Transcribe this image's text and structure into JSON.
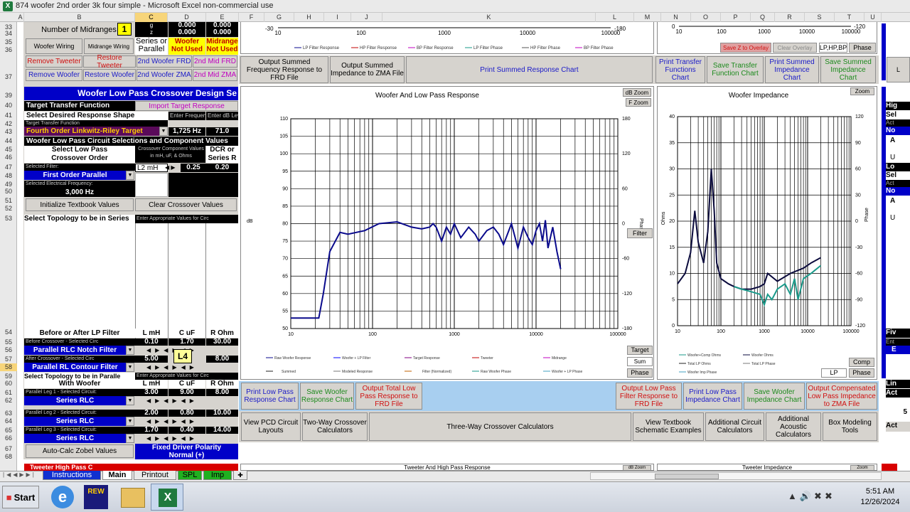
{
  "window": {
    "title": "874 woofer 2nd order 3k four simple - Microsoft Excel non-commercial use"
  },
  "columns": [
    "A",
    "B",
    "C",
    "D",
    "E",
    "F",
    "G",
    "H",
    "I",
    "J",
    "K",
    "L",
    "M",
    "N",
    "O",
    "P",
    "Q",
    "R",
    "S",
    "T",
    "U"
  ],
  "rows": [
    "33",
    "34",
    "35",
    "36",
    "37",
    "39",
    "40",
    "41",
    "42",
    "43",
    "44",
    "45",
    "46",
    "47",
    "48",
    "49",
    "50",
    "51",
    "52",
    "53",
    "54",
    "55",
    "56",
    "57",
    "58",
    "59",
    "60",
    "61",
    "62",
    "63",
    "64",
    "65",
    "66",
    "67",
    "68"
  ],
  "left": {
    "midranges_label": "Number of Midranges",
    "midranges_value": "1",
    "g_label": "g",
    "z_label": "z",
    "g_d": "0.000",
    "g_e": "0.000",
    "z_d": "0.000",
    "z_e": "0.000",
    "woofer_wiring": "Woofer Wiring",
    "midrange_wiring": "Midrange Wiring",
    "series_or_parallel": "Series or Parallel",
    "woofer_not_used": "Woofer Not Used",
    "midrange_not_used": "Midrange Not Used",
    "remove_tweeter": "Remove Tweeter",
    "restore_tweeter": "Restore Tweeter",
    "woofer2_frd": "2nd Woofer FRD",
    "mid2_frd": "2nd Mid FRD",
    "remove_woofer": "Remove Woofer",
    "restore_woofer": "Restore Woofer",
    "woofer2_zma": "2nd Woofer ZMA",
    "mid2_zma": "2nd Mid ZMA",
    "section_title": "Woofer Low Pass Crossover Design Se",
    "target_tf": "Target Transfer Function",
    "import_target": "Import Target Response",
    "select_shape": "Select Desired Response Shape",
    "enter_freq": "Enter Frequency",
    "enter_db": "Enter dB Level",
    "target_tf_small": "Target Transfer Function",
    "target_name": "Fourth Order Linkwitz-Riley Target",
    "freq_val": "1,725 Hz",
    "level_val": "71.0",
    "component_values": "Woofer Low Pass Circuit Selections and Component Values",
    "select_lp": "Select Low Pass",
    "crossover_order": "Crossover Order",
    "crossover_comp": "Crossover Component Values in mH, uF, & Ohms",
    "dcr": "DCR or",
    "series_r": "Series R",
    "selected_filter": "Selected Filter:",
    "filter_name": "First Order Parallel",
    "l2": "L2 mH",
    "l2_val": "0.25",
    "l2_r": "0.20",
    "sel_elec_freq": "Selected Electrical Frequency:",
    "freq3k": "3,000 Hz",
    "init_textbook": "Initialize Textbook Values",
    "clear_crossover": "Clear Crossover Values",
    "select_topology": "Select Topology to be in Series",
    "enter_appropriate": "Enter Appropriate Values for Circ",
    "before_after": "Before or After LP Filter",
    "l_mh": "L mH",
    "c_uf": "C uF",
    "r_ohm": "R Ohm",
    "before_sel": "Before Crossover - Selected Circ",
    "bf_l": "0.10",
    "bf_c": "1.70",
    "bf_r": "30.00",
    "notch": "Parallel RLC Notch Filter",
    "after_sel": "After Crossover - Selected Circ",
    "af_l": "5.00",
    "af_r": "8.00",
    "contour": "Parallel RL Contour Filter",
    "l4_tip": "L4",
    "topology_parallel": "Select Topology to be in Paralle",
    "enter_appropriate2": "Enter Appropriate Values for Circ",
    "with_woofer": "With Woofer",
    "leg1": "Parallel Leg 1 - Selected Circuit:",
    "leg1_l": "3.00",
    "leg1_c": "9.00",
    "leg1_r": "8.00",
    "series_rlc": "Series RLC",
    "leg2": "Parallel Leg 2 - Selected Circuit:",
    "leg2_l": "2.00",
    "leg2_c": "0.80",
    "leg2_r": "10.00",
    "leg3": "Parallel Leg 3 - Selected Circuit:",
    "leg3_l": "1.70",
    "leg3_c": "0.40",
    "leg3_r": "14.00",
    "autocalc": "Auto-Calc Zobel Values",
    "fixed_polarity": "Fixed Driver Polarity",
    "normal": "Normal (+)"
  },
  "top_charts": {
    "left_ticks": [
      "10",
      "100",
      "1000",
      "10000",
      "100000"
    ],
    "left_rt": "-180",
    "left_lt": "-30",
    "left_legend": [
      "LP Filter Response",
      "HP Filter Response",
      "BP Filter Response",
      "LP Filter Phase",
      "HP Filter Phase",
      "BP Filter Phase"
    ],
    "right_ticks": [
      "10",
      "100",
      "1000",
      "10000",
      "100000"
    ],
    "right_lt": "0",
    "right_rt": "-120",
    "save_z": "Save Z to Overlay",
    "clear_overlay": "Clear Overlay",
    "lphpbp": "LP,HP,BP",
    "phase": "Phase"
  },
  "buttons_row1": {
    "out_frd": "Output Summed Frequency Response to FRD File",
    "out_zma": "Output Summed Impedance to ZMA File",
    "print_summed": "Print Summed Response Chart",
    "print_tf": "Print Transfer Functions Chart",
    "save_tf": "Save Transfer Function Chart",
    "print_imp": "Print Summed Impedance Chart",
    "save_imp": "Save Summed Impedance Chart"
  },
  "response_chart": {
    "title": "Woofer And Low Pass Response",
    "db_zoom": "dB Zoom",
    "f_zoom": "F Zoom",
    "filter": "Filter",
    "target": "Target",
    "sum": "Sum",
    "phase": "Phase",
    "ylabel": "dB",
    "y2label": "Phase",
    "legend": [
      "Raw Woofer Response",
      "Woofer + LP Filter",
      "Target Response",
      "Tweeter",
      "Midrange",
      "Summed",
      "Modeled Response",
      "Filter (Normalized)",
      "Raw Woofer Phase",
      "Woofer + LP Phase"
    ]
  },
  "impedance_chart": {
    "title": "Woofer Impedance",
    "zoom": "Zoom",
    "comp": "Comp",
    "lp": "LP",
    "phase": "Phase",
    "ylabel": "Ohms",
    "y2label": "Phase",
    "legend": [
      "Woofer+Comp Ohms",
      "Woofer Ohms",
      "Total LP Ohms",
      "Total LP Phase",
      "Woofer Imp Phase"
    ]
  },
  "chart_data": [
    {
      "type": "line",
      "title": "Woofer And Low Pass Response",
      "xlabel": "",
      "ylabel": "dB",
      "xscale": "log",
      "xlim": [
        10,
        100000
      ],
      "ylim": [
        50,
        110
      ],
      "y2lim": [
        -180,
        180
      ],
      "x_ticks": [
        "10",
        "100",
        "1000",
        "10000",
        "100000"
      ],
      "y_ticks": [
        "50",
        "55",
        "60",
        "65",
        "70",
        "75",
        "80",
        "85",
        "90",
        "95",
        "100",
        "105",
        "110"
      ],
      "y2_ticks": [
        "-180",
        "-120",
        "-60",
        "0",
        "60",
        "120",
        "180"
      ],
      "series": [
        {
          "name": "Woofer + LP Filter",
          "x": [
            10,
            20,
            22,
            25,
            30,
            40,
            50,
            80,
            120,
            200,
            300,
            400,
            500,
            550,
            600,
            700,
            800,
            900,
            1000,
            1200,
            1500,
            1800,
            2000,
            2500,
            3000,
            3500,
            4000,
            5000,
            6000,
            7000,
            8000,
            9000,
            10000,
            11000,
            12000,
            13000,
            14000,
            16000,
            18000,
            20000
          ],
          "y": [
            53,
            53,
            53,
            60,
            72,
            77.5,
            77,
            78,
            80,
            80.5,
            79,
            78.5,
            79,
            80,
            79,
            75,
            79,
            77,
            80,
            76,
            79,
            77,
            75,
            78,
            79,
            77,
            74,
            80,
            73,
            79,
            76,
            74,
            78,
            80,
            75,
            81,
            73,
            79,
            72,
            67
          ]
        }
      ]
    },
    {
      "type": "line",
      "title": "Woofer Impedance",
      "xlabel": "",
      "ylabel": "Ohms",
      "xscale": "log",
      "xlim": [
        10,
        100000
      ],
      "ylim": [
        0,
        40
      ],
      "y2lim": [
        -120,
        120
      ],
      "x_ticks": [
        "10",
        "100",
        "1000",
        "10000",
        "100000"
      ],
      "y_ticks": [
        "0",
        "5",
        "10",
        "15",
        "20",
        "25",
        "30",
        "35",
        "40"
      ],
      "y2_ticks": [
        "-120",
        "-90",
        "-60",
        "-30",
        "0",
        "30",
        "60",
        "90",
        "120"
      ],
      "series": [
        {
          "name": "Woofer Ohms",
          "x": [
            10,
            15,
            20,
            25,
            30,
            40,
            50,
            60,
            70,
            80,
            100,
            150,
            200,
            300,
            500,
            800,
            1000,
            1200,
            2000,
            4000,
            8000,
            12000,
            20000
          ],
          "y": [
            8,
            10,
            14,
            22,
            16,
            12,
            18,
            30,
            22,
            12,
            9,
            8,
            7.5,
            7,
            7,
            7.5,
            8,
            10,
            8.5,
            10,
            11,
            12,
            13
          ]
        },
        {
          "name": "Woofer+Comp Ohms",
          "x": [
            200,
            300,
            500,
            800,
            1000,
            1200,
            1500,
            2000,
            3000,
            4000,
            5000,
            6000,
            8000,
            12000,
            20000
          ],
          "y": [
            7.5,
            7,
            6.5,
            6,
            4,
            6,
            5,
            7,
            8,
            6,
            9,
            5,
            9,
            10,
            11.5
          ]
        }
      ]
    }
  ],
  "bottom_buttons": {
    "print_lp": "Print Low Pass Response Chart",
    "save_woofer_resp": "Save Woofer Response Chart",
    "out_total_lp": "Output Total Low Pass Response to FRD File",
    "out_lp_filter": "Output Low Pass Filter Response to FRD File",
    "print_lp_imp": "Print Low Pass Impedance Chart",
    "save_woofer_imp": "Save Woofer Impedance Chart",
    "out_comp_zma": "Output Compensated Low Pass Impedance to ZMA File",
    "pcd": "View PCD Circuit Layouts",
    "twoway": "Two-Way Crossover Calculators",
    "threeway": "Three-Way Crossover Calculators",
    "textbook": "View Textbook Schematic Examples",
    "add_circuit": "Additional Circuit Calculators",
    "add_acoustic": "Additional Acoustic Calculators",
    "box": "Box Modeling Tools"
  },
  "right_edge": {
    "hig": "Hig",
    "sel": "Sel",
    "act": "Act",
    "no": "No",
    "a": "A",
    "u": "U",
    "lo": "Lo",
    "fiv": "Fiv",
    "ent": "Ent",
    "e": "E",
    "lin": "Lin",
    "act2": "Act",
    "five": "5"
  },
  "bottom_row68": {
    "left": "Tweeter High Pass C",
    "mid": "Tweeter And High Pass Response",
    "right": "Tweeter Impedance",
    "db_zoom": "dB Zoom",
    "zoom": "Zoom"
  },
  "tabs": [
    {
      "label": "Instructions",
      "active": false
    },
    {
      "label": "Main",
      "active": true
    },
    {
      "label": "Printout",
      "active": false
    },
    {
      "label": "SPL",
      "active": false
    },
    {
      "label": "Imp",
      "active": false
    }
  ],
  "taskbar": {
    "start": "Start",
    "time": "5:51 AM",
    "date": "12/26/2024"
  },
  "colors": {
    "accent_blue": "#0000c8",
    "excel_green": "#1f7a3e",
    "curve_navy": "#0a0a8c",
    "curve_teal": "#1a9a8a",
    "tip_yellow": "#ffff99"
  }
}
